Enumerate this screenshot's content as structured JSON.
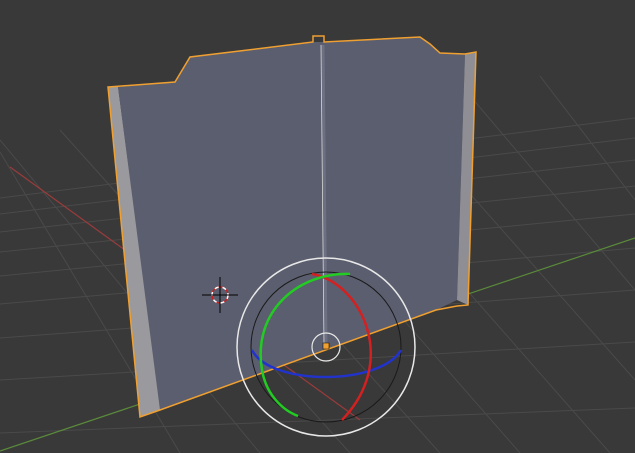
{
  "viewport": {
    "background": "#393939",
    "grid_color": "#4a4a4a",
    "x_axis_color": "#9b3b3b",
    "y_axis_color": "#5a8a3a"
  },
  "selected_object": {
    "face_color": "#5b5e6e",
    "side_color": "#9a9a9e",
    "outline_color": "#f0a030"
  },
  "gizmo": {
    "mode": "rotate",
    "axis_x_color": "#d42020",
    "axis_y_color": "#22cc22",
    "axis_z_color": "#2233cc",
    "trackball_color": "#1a1a1a",
    "view_ring_color": "#e8e8e8"
  },
  "cursor_3d": {
    "ring_colors": [
      "#c82020",
      "#ffffff"
    ]
  }
}
